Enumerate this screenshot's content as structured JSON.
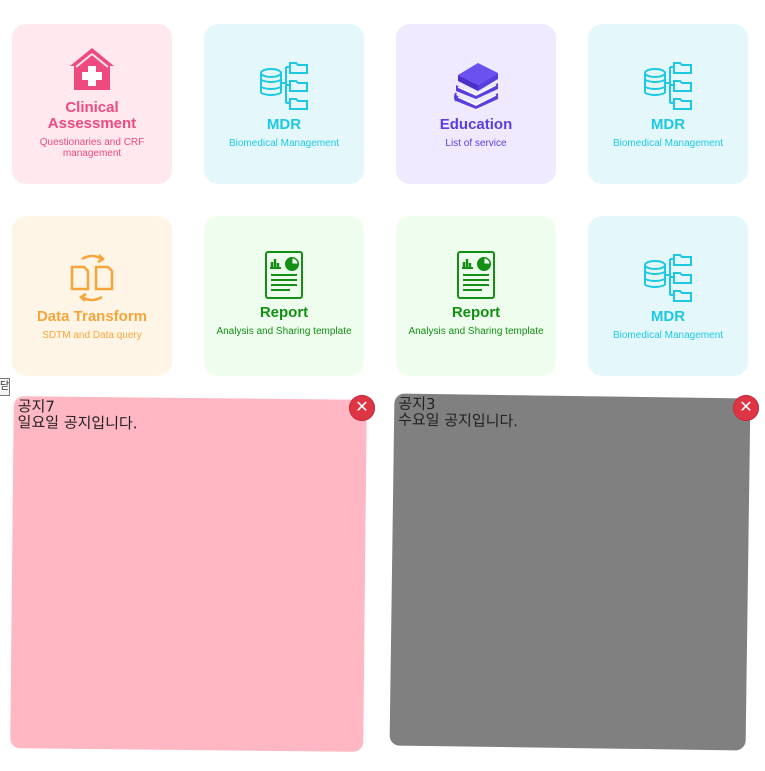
{
  "cards": [
    {
      "title": "Clinical Assessment",
      "subtitle": "Questionaries and CRF management",
      "icon": "house-plus-icon"
    },
    {
      "title": "MDR",
      "subtitle": "Biomedical Management",
      "icon": "database-tree-icon"
    },
    {
      "title": "Education",
      "subtitle": "List of service",
      "icon": "books-icon"
    },
    {
      "title": "MDR",
      "subtitle": "Biomedical Management",
      "icon": "database-tree-icon"
    },
    {
      "title": "Data Transform",
      "subtitle": "SDTM and Data query",
      "icon": "transform-cycle-icon"
    },
    {
      "title": "Report",
      "subtitle": "Analysis and Sharing template",
      "icon": "report-document-icon"
    },
    {
      "title": "Report",
      "subtitle": "Analysis and Sharing template",
      "icon": "report-document-icon"
    },
    {
      "title": "MDR",
      "subtitle": "Biomedical Management",
      "icon": "database-tree-icon"
    }
  ],
  "notices": [
    {
      "title": "공지7",
      "body": "일요일 공지입니다.",
      "color": "#ffb7c3"
    },
    {
      "title": "공지3",
      "body": "수요일 공지입니다.",
      "color": "#808080"
    }
  ],
  "stub_label": "닫",
  "colors": {
    "pink": "#ee4a7e",
    "cyan": "#1ec8e3",
    "purple": "#5a3fe0",
    "orange": "#f7a53a",
    "green": "#139013",
    "close": "#dd3544"
  }
}
